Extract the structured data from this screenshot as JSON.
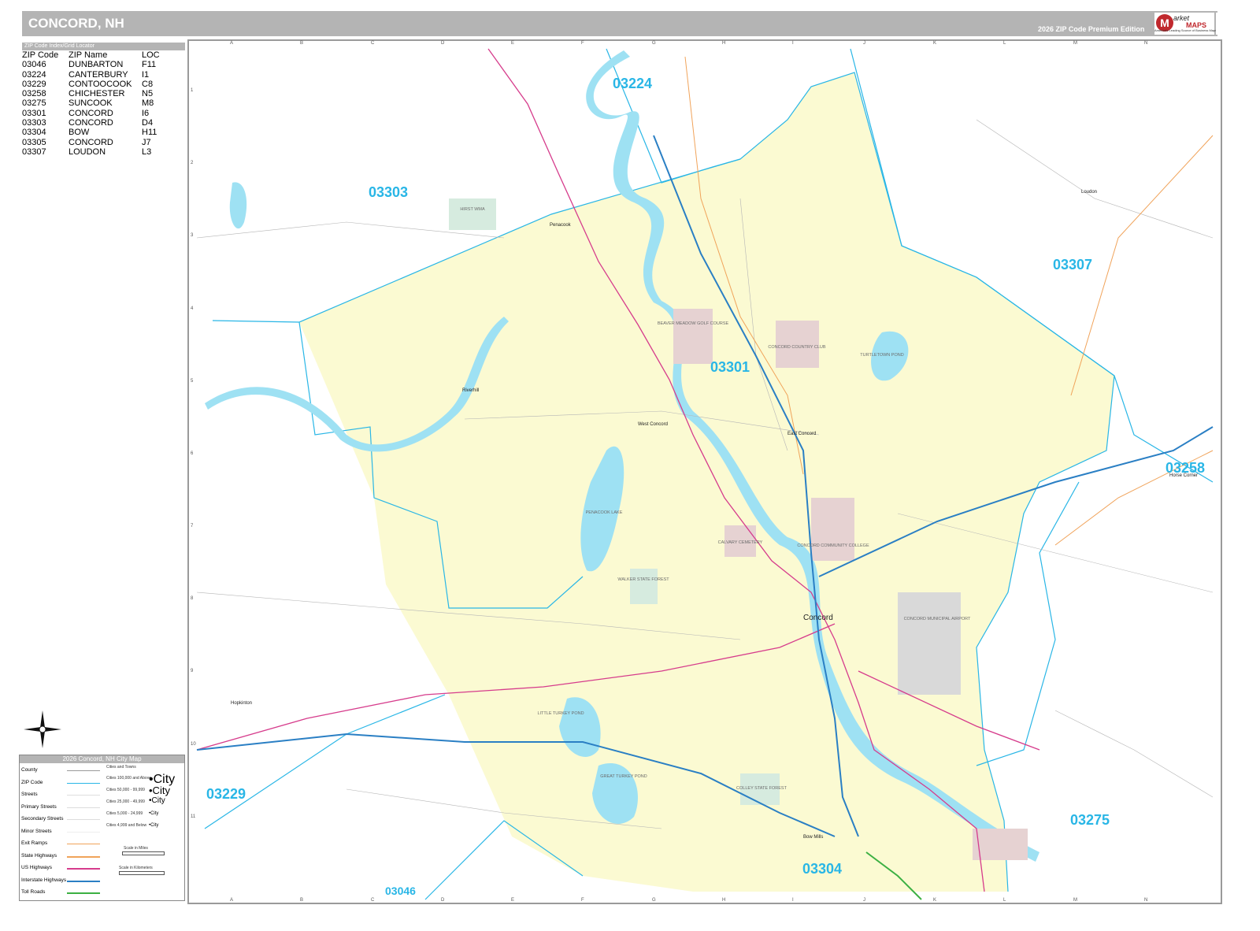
{
  "header": {
    "title": "CONCORD, NH",
    "edition": "2026 ZIP Code Premium Edition",
    "logo_letter": "M",
    "logo_word1": "arket",
    "logo_word2": "MAPS",
    "logo_tagline": "America's Leading Source of Business Maps"
  },
  "locator": {
    "heading": "ZIP Code Index/Grid Locator",
    "columns": [
      "ZIP Code",
      "ZIP Name",
      "LOC"
    ],
    "rows": [
      [
        "03046",
        "DUNBARTON",
        "F11"
      ],
      [
        "03224",
        "CANTERBURY",
        "I1"
      ],
      [
        "03229",
        "CONTOOCOOK",
        "C8"
      ],
      [
        "03258",
        "CHICHESTER",
        "N5"
      ],
      [
        "03275",
        "SUNCOOK",
        "M8"
      ],
      [
        "03301",
        "CONCORD",
        "I6"
      ],
      [
        "03303",
        "CONCORD",
        "D4"
      ],
      [
        "03304",
        "BOW",
        "H11"
      ],
      [
        "03305",
        "CONCORD",
        "J7"
      ],
      [
        "03307",
        "LOUDON",
        "L3"
      ]
    ]
  },
  "grid": {
    "columns": [
      "A",
      "B",
      "C",
      "D",
      "E",
      "F",
      "G",
      "H",
      "I",
      "J",
      "K",
      "L",
      "M",
      "N"
    ],
    "rows": [
      "1",
      "2",
      "3",
      "4",
      "5",
      "6",
      "7",
      "8",
      "9",
      "10",
      "11"
    ]
  },
  "map": {
    "zip_labels": [
      "03224",
      "03303",
      "03301",
      "03307",
      "03258",
      "03229",
      "03275",
      "03304",
      "03046"
    ],
    "places": [
      "Penacook",
      "Riverhill",
      "West Concord",
      "East Concord",
      "Concord",
      "Hopkinton",
      "Bow Mills",
      "Loudon",
      "Horse Corner"
    ],
    "features": [
      "HIRST WMA",
      "BEAVER MEADOW GOLF COURSE",
      "CONCORD COUNTRY CLUB",
      "TURTLETOWN POND",
      "PENACOOK LAKE",
      "CALVARY CEMETERY",
      "CONCORD COMMUNITY COLLEGE",
      "WALKER STATE FOREST",
      "CONCORD MUNICIPAL AIRPORT",
      "LITTLE TURKEY POND",
      "GREAT TURKEY POND",
      "COLLEY STATE FOREST"
    ],
    "colors": {
      "zip_fill": "#fbfad2",
      "zip_line": "#29b6e6",
      "water": "#9ee1f3",
      "park": "#d6ebdf",
      "special": "#e6d2d2",
      "us_highway": "#d63c8c",
      "interstate": "#2a7fc4",
      "state_highway": "#f0a35a",
      "toll": "#3cb043",
      "street": "#b5b5b5"
    }
  },
  "legend": {
    "title": "2026 Concord, NH City Map",
    "items": [
      "County",
      "ZIP Code",
      "Streets",
      "Primary Streets",
      "Secondary Streets",
      "Minor Streets",
      "Exit Ramps",
      "State Highways",
      "US Highways",
      "Interstate Highways",
      "Toll Roads"
    ],
    "cities_heading": "Cities and Towns",
    "city_classes": [
      {
        "range": "Cities 100,000 and Above",
        "sample": "City"
      },
      {
        "range": "Cities 50,000 - 99,999",
        "sample": "City"
      },
      {
        "range": "Cities 25,000 - 49,999",
        "sample": "City"
      },
      {
        "range": "Cities 5,000 - 24,999",
        "sample": "City"
      },
      {
        "range": "Cities 4,999 and Below",
        "sample": "City"
      }
    ],
    "scale_miles": "Scale in Miles",
    "scale_km": "Scale in Kilometers"
  }
}
